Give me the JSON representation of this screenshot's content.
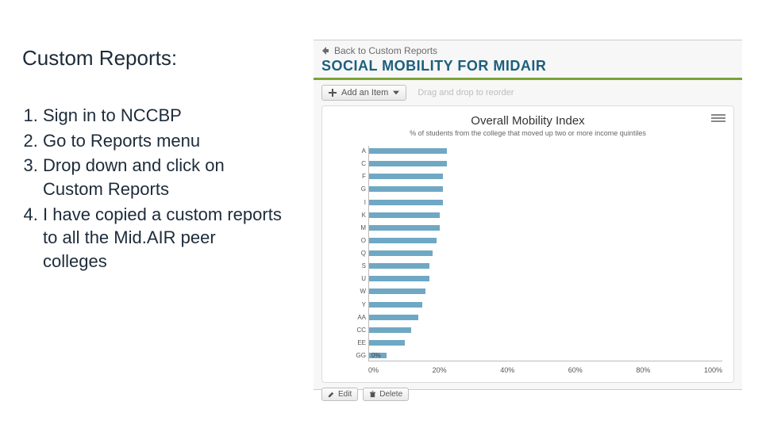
{
  "left": {
    "heading": "Custom Reports:",
    "steps": [
      "Sign in to NCCBP",
      "Go to Reports menu",
      "Drop down and click on Custom Reports",
      "I have copied a custom reports to all the Mid.AIR peer colleges"
    ]
  },
  "ui": {
    "back_label": "Back to Custom Reports",
    "report_title": "SOCIAL MOBILITY FOR MIDAIR",
    "add_item_label": "Add an Item",
    "reorder_hint": "Drag and drop to reorder",
    "edit_label": "Edit",
    "delete_label": "Delete"
  },
  "chart_data": {
    "type": "bar",
    "orientation": "horizontal",
    "title": "Overall Mobility Index",
    "subtitle": "% of students from the college that moved up two or more income quintiles",
    "xlabel": "",
    "ylabel": "",
    "xlim": [
      0,
      100
    ],
    "x_ticks": [
      "0%",
      "20%",
      "40%",
      "60%",
      "80%",
      "100%"
    ],
    "annotation": "0%",
    "series": [
      {
        "name": "mobility",
        "color": "#6fa8c4",
        "data": [
          {
            "label": "A",
            "value": 22
          },
          {
            "label": "C",
            "value": 22
          },
          {
            "label": "F",
            "value": 21
          },
          {
            "label": "G",
            "value": 21
          },
          {
            "label": "I",
            "value": 21
          },
          {
            "label": "K",
            "value": 20
          },
          {
            "label": "M",
            "value": 20
          },
          {
            "label": "O",
            "value": 19
          },
          {
            "label": "Q",
            "value": 18
          },
          {
            "label": "S",
            "value": 17
          },
          {
            "label": "U",
            "value": 17
          },
          {
            "label": "W",
            "value": 16
          },
          {
            "label": "Y",
            "value": 15
          },
          {
            "label": "AA",
            "value": 14
          },
          {
            "label": "CC",
            "value": 12
          },
          {
            "label": "EE",
            "value": 10
          },
          {
            "label": "GG",
            "value": 5
          }
        ]
      }
    ]
  }
}
